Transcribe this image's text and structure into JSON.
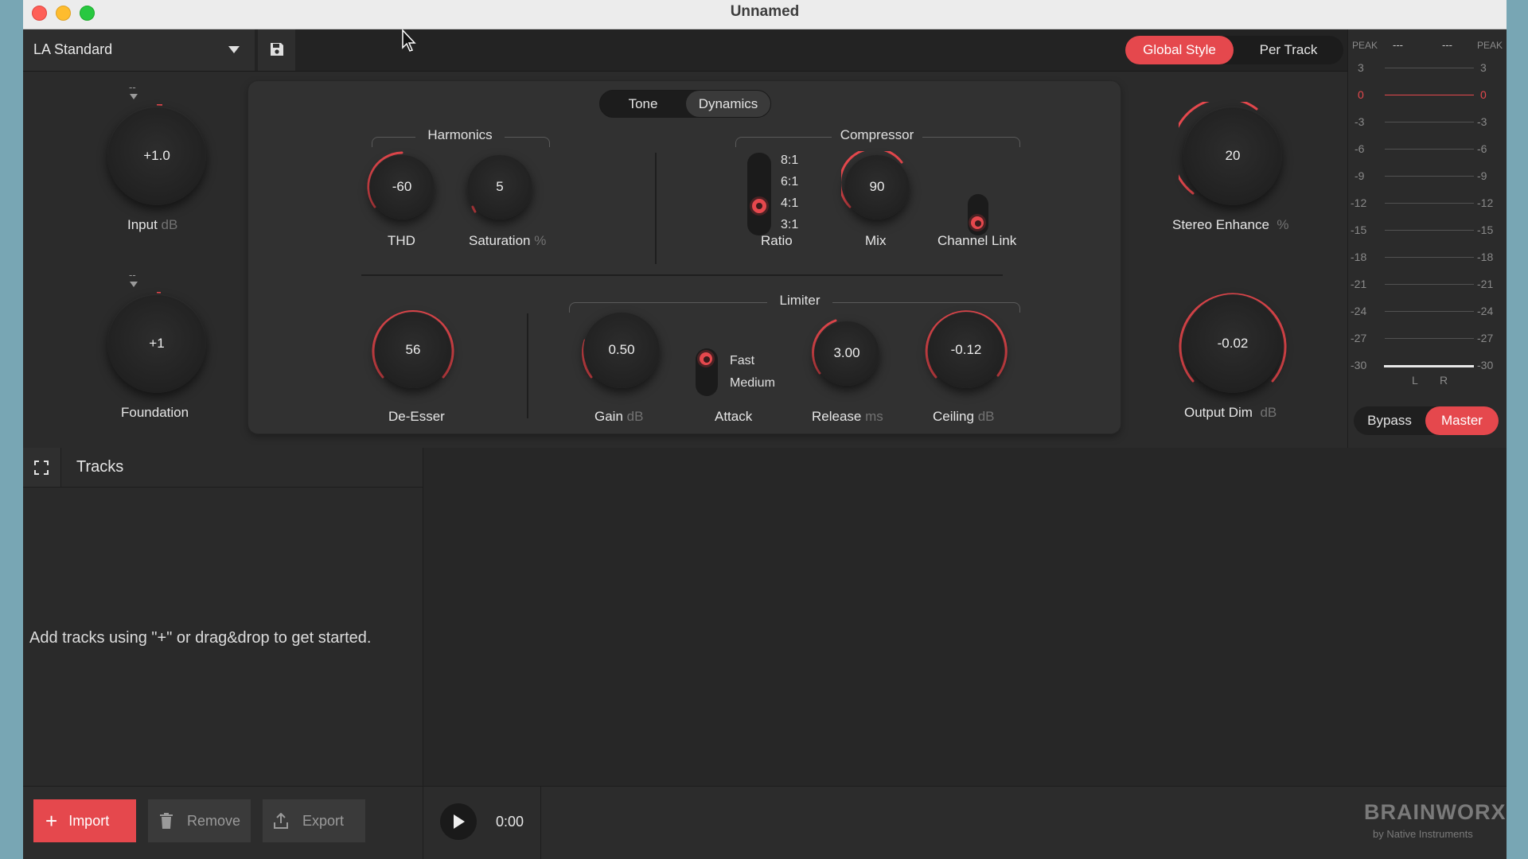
{
  "window": {
    "title": "Unnamed"
  },
  "preset": {
    "name": "LA Standard"
  },
  "mode": {
    "options": [
      "Global Style",
      "Per Track"
    ],
    "selected": "Global Style"
  },
  "panel_tabs": {
    "options": [
      "Tone",
      "Dynamics"
    ],
    "selected": "Dynamics"
  },
  "left": {
    "input": {
      "value": "+1.0",
      "label": "Input",
      "unit": "dB",
      "marker": "--"
    },
    "foundation": {
      "value": "+1",
      "label": "Foundation",
      "marker": "--"
    }
  },
  "harmonics": {
    "title": "Harmonics",
    "thd": {
      "value": "-60",
      "label": "THD"
    },
    "saturation": {
      "value": "5",
      "label": "Saturation",
      "unit": "%"
    }
  },
  "compressor": {
    "title": "Compressor",
    "ratio": {
      "label": "Ratio",
      "options": [
        "8:1",
        "6:1",
        "4:1",
        "3:1"
      ],
      "selected": "4:1"
    },
    "mix": {
      "value": "90",
      "label": "Mix"
    },
    "channel_link": {
      "label": "Channel Link"
    }
  },
  "deesser": {
    "value": "56",
    "label": "De-Esser"
  },
  "limiter": {
    "title": "Limiter",
    "gain": {
      "value": "0.50",
      "label": "Gain",
      "unit": "dB"
    },
    "attack": {
      "label": "Attack",
      "options": [
        "Fast",
        "Medium"
      ],
      "selected": "Fast"
    },
    "release": {
      "value": "3.00",
      "label": "Release",
      "unit": "ms"
    },
    "ceiling": {
      "value": "-0.12",
      "label": "Ceiling",
      "unit": "dB"
    }
  },
  "right": {
    "stereo": {
      "value": "20",
      "label": "Stereo Enhance",
      "unit": "%"
    },
    "output": {
      "value": "-0.02",
      "label": "Output Dim",
      "unit": "dB"
    }
  },
  "meter": {
    "peak_label": "PEAK",
    "peak_left": "---",
    "peak_right": "---",
    "scale": [
      "3",
      "0",
      "-3",
      "-6",
      "-9",
      "-12",
      "-15",
      "-18",
      "-21",
      "-24",
      "-27",
      "-30"
    ],
    "channels": [
      "L",
      "R"
    ],
    "bypass": "Bypass",
    "master": "Master"
  },
  "tracks": {
    "title": "Tracks",
    "empty_message": "Add tracks using \"+\" or drag&drop to get started."
  },
  "footer": {
    "import": "Import",
    "remove": "Remove",
    "export": "Export",
    "time": "0:00",
    "brand": "BRAINWORX",
    "brand_sub": "by Native Instruments"
  },
  "colors": {
    "accent": "#e5484d",
    "background": "#2b2b2b",
    "panel": "#313131"
  }
}
